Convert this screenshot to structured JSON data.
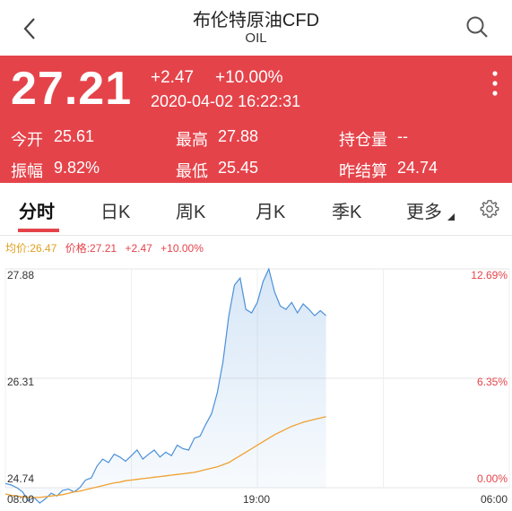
{
  "header": {
    "title": "布伦特原油CFD",
    "subtitle": "OIL"
  },
  "quote": {
    "price": "27.21",
    "change": "+2.47",
    "change_pct": "+10.00%",
    "datetime": "2020-04-02 16:22:31",
    "stats": {
      "open_label": "今开",
      "open_value": "25.61",
      "high_label": "最高",
      "high_value": "27.88",
      "oi_label": "持仓量",
      "oi_value": "--",
      "amp_label": "振幅",
      "amp_value": "9.82%",
      "low_label": "最低",
      "low_value": "25.45",
      "prev_label": "昨结算",
      "prev_value": "24.74"
    },
    "color": "#e5434a"
  },
  "tabs": [
    {
      "label": "分时",
      "active": true
    },
    {
      "label": "日K"
    },
    {
      "label": "周K"
    },
    {
      "label": "月K"
    },
    {
      "label": "季K"
    },
    {
      "label": "更多"
    }
  ],
  "info_line": {
    "avg_label": "均价:26.47",
    "price_label": "价格:27.21",
    "change": "+2.47",
    "change_pct": "+10.00%"
  },
  "chart_data": {
    "type": "line",
    "y_left_ticks": [
      "27.88",
      "26.31",
      "24.74"
    ],
    "y_right_ticks": [
      "12.69%",
      "6.35%",
      "0.00%"
    ],
    "x_ticks": [
      "08:00",
      "19:00",
      "06:00"
    ],
    "ylim": [
      24.74,
      27.88
    ],
    "x_sessions_total": 89,
    "series": [
      {
        "color": "#4a90d9",
        "values": [
          24.8,
          24.78,
          24.74,
          24.68,
          24.55,
          24.6,
          24.52,
          24.58,
          24.66,
          24.62,
          24.7,
          24.72,
          24.68,
          24.74,
          24.85,
          24.88,
          25.05,
          25.15,
          25.1,
          25.22,
          25.18,
          25.12,
          25.2,
          25.28,
          25.15,
          25.22,
          25.28,
          25.18,
          25.25,
          25.2,
          25.35,
          25.3,
          25.28,
          25.45,
          25.48,
          25.65,
          25.8,
          26.1,
          26.55,
          27.2,
          27.65,
          27.75,
          27.3,
          27.25,
          27.4,
          27.7,
          27.88,
          27.55,
          27.35,
          27.3,
          27.4,
          27.25,
          27.38,
          27.3,
          27.21,
          27.28,
          27.21
        ]
      },
      {
        "color": "#f0a030",
        "values": [
          24.65,
          24.63,
          24.62,
          24.61,
          24.6,
          24.6,
          24.6,
          24.61,
          24.62,
          24.63,
          24.64,
          24.66,
          24.68,
          24.69,
          24.71,
          24.73,
          24.75,
          24.77,
          24.79,
          24.81,
          24.82,
          24.84,
          24.85,
          24.86,
          24.87,
          24.88,
          24.89,
          24.9,
          24.91,
          24.92,
          24.93,
          24.94,
          24.95,
          24.96,
          24.98,
          25.0,
          25.02,
          25.04,
          25.07,
          25.1,
          25.15,
          25.2,
          25.25,
          25.3,
          25.35,
          25.4,
          25.45,
          25.5,
          25.54,
          25.58,
          25.62,
          25.65,
          25.68,
          25.7,
          25.72,
          25.74,
          25.76
        ]
      }
    ]
  }
}
